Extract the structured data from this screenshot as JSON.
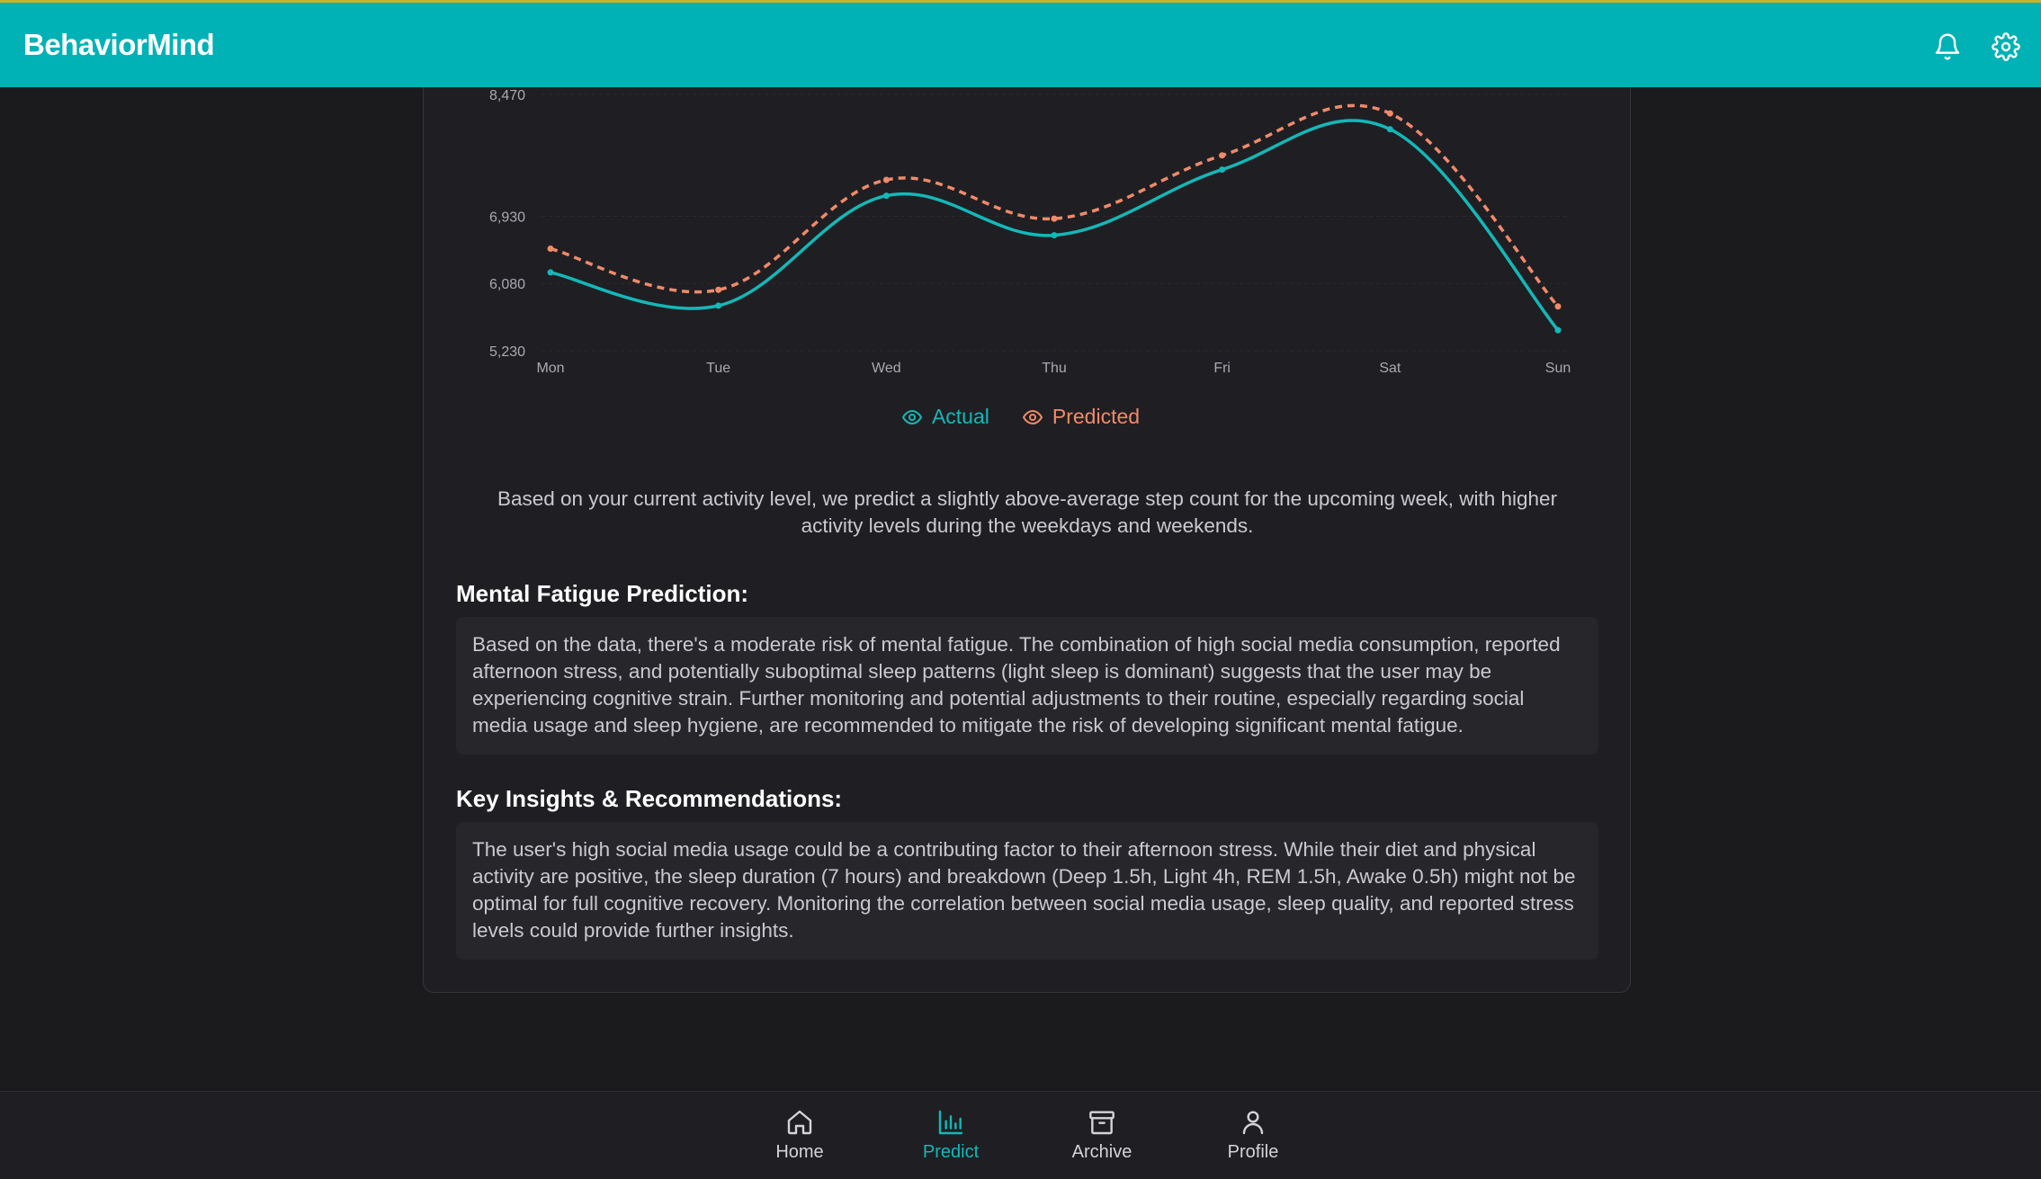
{
  "app": {
    "title": "BehaviorMind"
  },
  "header": {
    "icons": [
      "bell-icon",
      "gear-icon"
    ]
  },
  "colors": {
    "accent": "#00b2b5",
    "actual": "#14b8b8",
    "predicted": "#f08a6a",
    "background": "#1b1b1e"
  },
  "chart_data": {
    "type": "line",
    "categories": [
      "Mon",
      "Tue",
      "Wed",
      "Thu",
      "Fri",
      "Sat",
      "Sun"
    ],
    "yticks": [
      "8,470",
      "6,930",
      "6,080",
      "5,230"
    ],
    "ytick_values": [
      8470,
      6930,
      6080,
      5230
    ],
    "ylim": [
      5230,
      8470
    ],
    "series": [
      {
        "name": "Actual",
        "values": [
          6220,
          5800,
          7190,
          6690,
          7520,
          8030,
          5490
        ],
        "style": "solid"
      },
      {
        "name": "Predicted",
        "values": [
          6520,
          6000,
          7390,
          6900,
          7700,
          8230,
          5790
        ],
        "style": "dashed"
      }
    ],
    "grid": true,
    "legend": "bottom-center"
  },
  "legend": {
    "actual": "Actual",
    "predicted": "Predicted"
  },
  "summary": "Based on your current activity level, we predict a slightly above-average step count for the upcoming week, with higher activity levels during the weekdays and weekends.",
  "mental_fatigue": {
    "title": "Mental Fatigue Prediction:",
    "text": "Based on the data, there's a moderate risk of mental fatigue. The combination of high social media consumption, reported afternoon stress, and potentially suboptimal sleep patterns (light sleep is dominant) suggests that the user may be experiencing cognitive strain. Further monitoring and potential adjustments to their routine, especially regarding social media usage and sleep hygiene, are recommended to mitigate the risk of developing significant mental fatigue."
  },
  "insights": {
    "title": "Key Insights & Recommendations:",
    "text": "The user's high social media usage could be a contributing factor to their afternoon stress. While their diet and physical activity are positive, the sleep duration (7 hours) and breakdown (Deep 1.5h, Light 4h, REM 1.5h, Awake 0.5h) might not be optimal for full cognitive recovery. Monitoring the correlation between social media usage, sleep quality, and reported stress levels could provide further insights."
  },
  "nav": {
    "items": [
      {
        "label": "Home",
        "icon": "home-icon"
      },
      {
        "label": "Predict",
        "icon": "bar-chart-icon",
        "active": true
      },
      {
        "label": "Archive",
        "icon": "archive-icon"
      },
      {
        "label": "Profile",
        "icon": "user-icon"
      }
    ]
  }
}
